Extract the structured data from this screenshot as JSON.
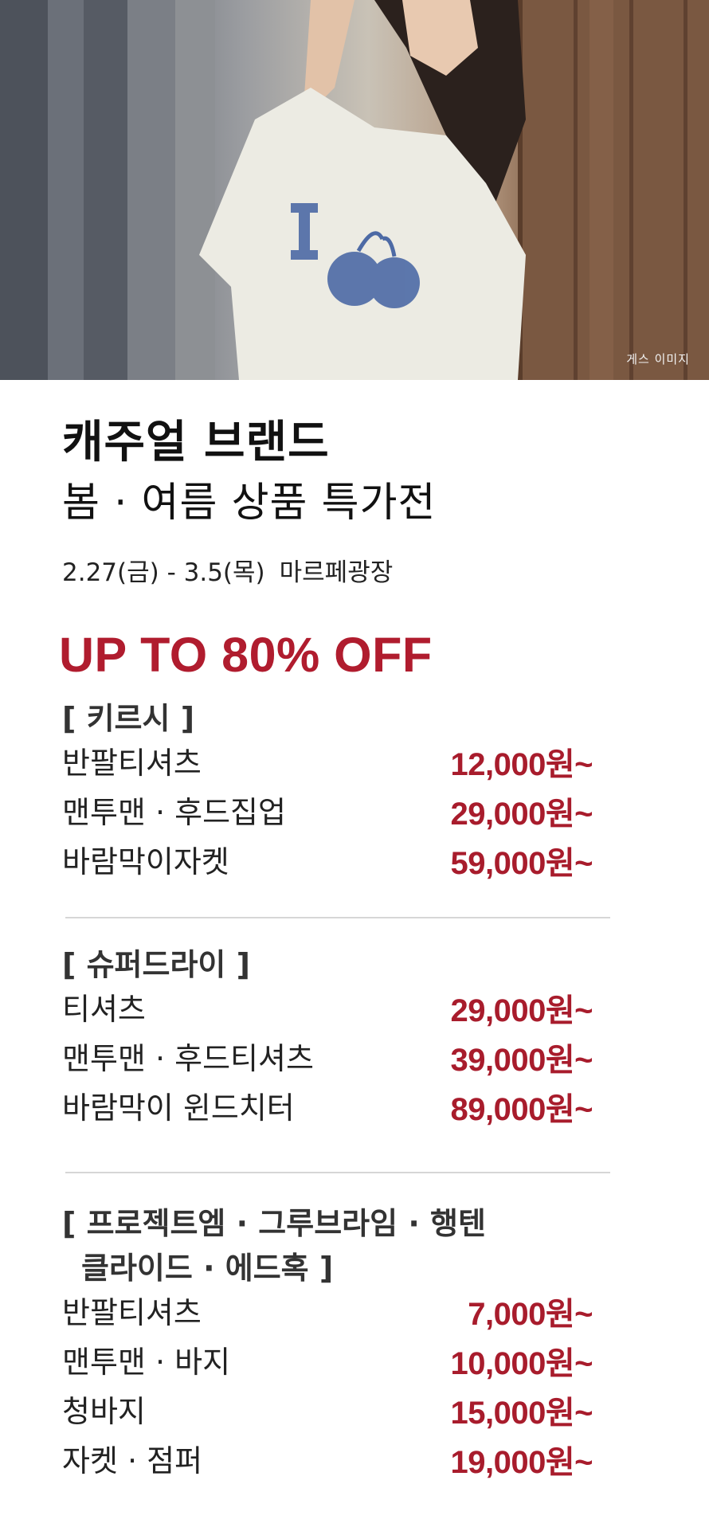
{
  "hero": {
    "caption": "게스 이미지"
  },
  "heading": {
    "title": "캐주얼 브랜드",
    "subtitle": "봄 · 여름 상품 특가전",
    "date_range": "2.27(금) - 3.5(목)",
    "location": "마르페광장",
    "discount": "UP TO 80% OFF"
  },
  "sections": [
    {
      "title": "[ 키르시 ]",
      "items": [
        {
          "name": "반팔티셔츠",
          "price": "12,000원~"
        },
        {
          "name": "맨투맨 · 후드집업",
          "price": "29,000원~"
        },
        {
          "name": "바람막이자켓",
          "price": "59,000원~"
        }
      ]
    },
    {
      "title": "[ 슈퍼드라이 ]",
      "items": [
        {
          "name": "티셔츠",
          "price": "29,000원~"
        },
        {
          "name": "맨투맨 · 후드티셔츠",
          "price": "39,000원~"
        },
        {
          "name": "바람막이 윈드치터",
          "price": "89,000원~"
        }
      ]
    },
    {
      "title_line1": "[ 프로젝트엠 · 그루브라임 · 행텐",
      "title_line2": "클라이드 · 에드혹 ]",
      "items": [
        {
          "name": "반팔티셔츠",
          "price": "7,000원~"
        },
        {
          "name": "맨투맨 · 바지",
          "price": "10,000원~"
        },
        {
          "name": "청바지",
          "price": "15,000원~"
        },
        {
          "name": "자켓 · 점퍼",
          "price": "19,000원~"
        }
      ]
    }
  ],
  "colors": {
    "accent": "#b01c2e",
    "price": "#a81c2c",
    "divider": "#d6d6d6"
  }
}
